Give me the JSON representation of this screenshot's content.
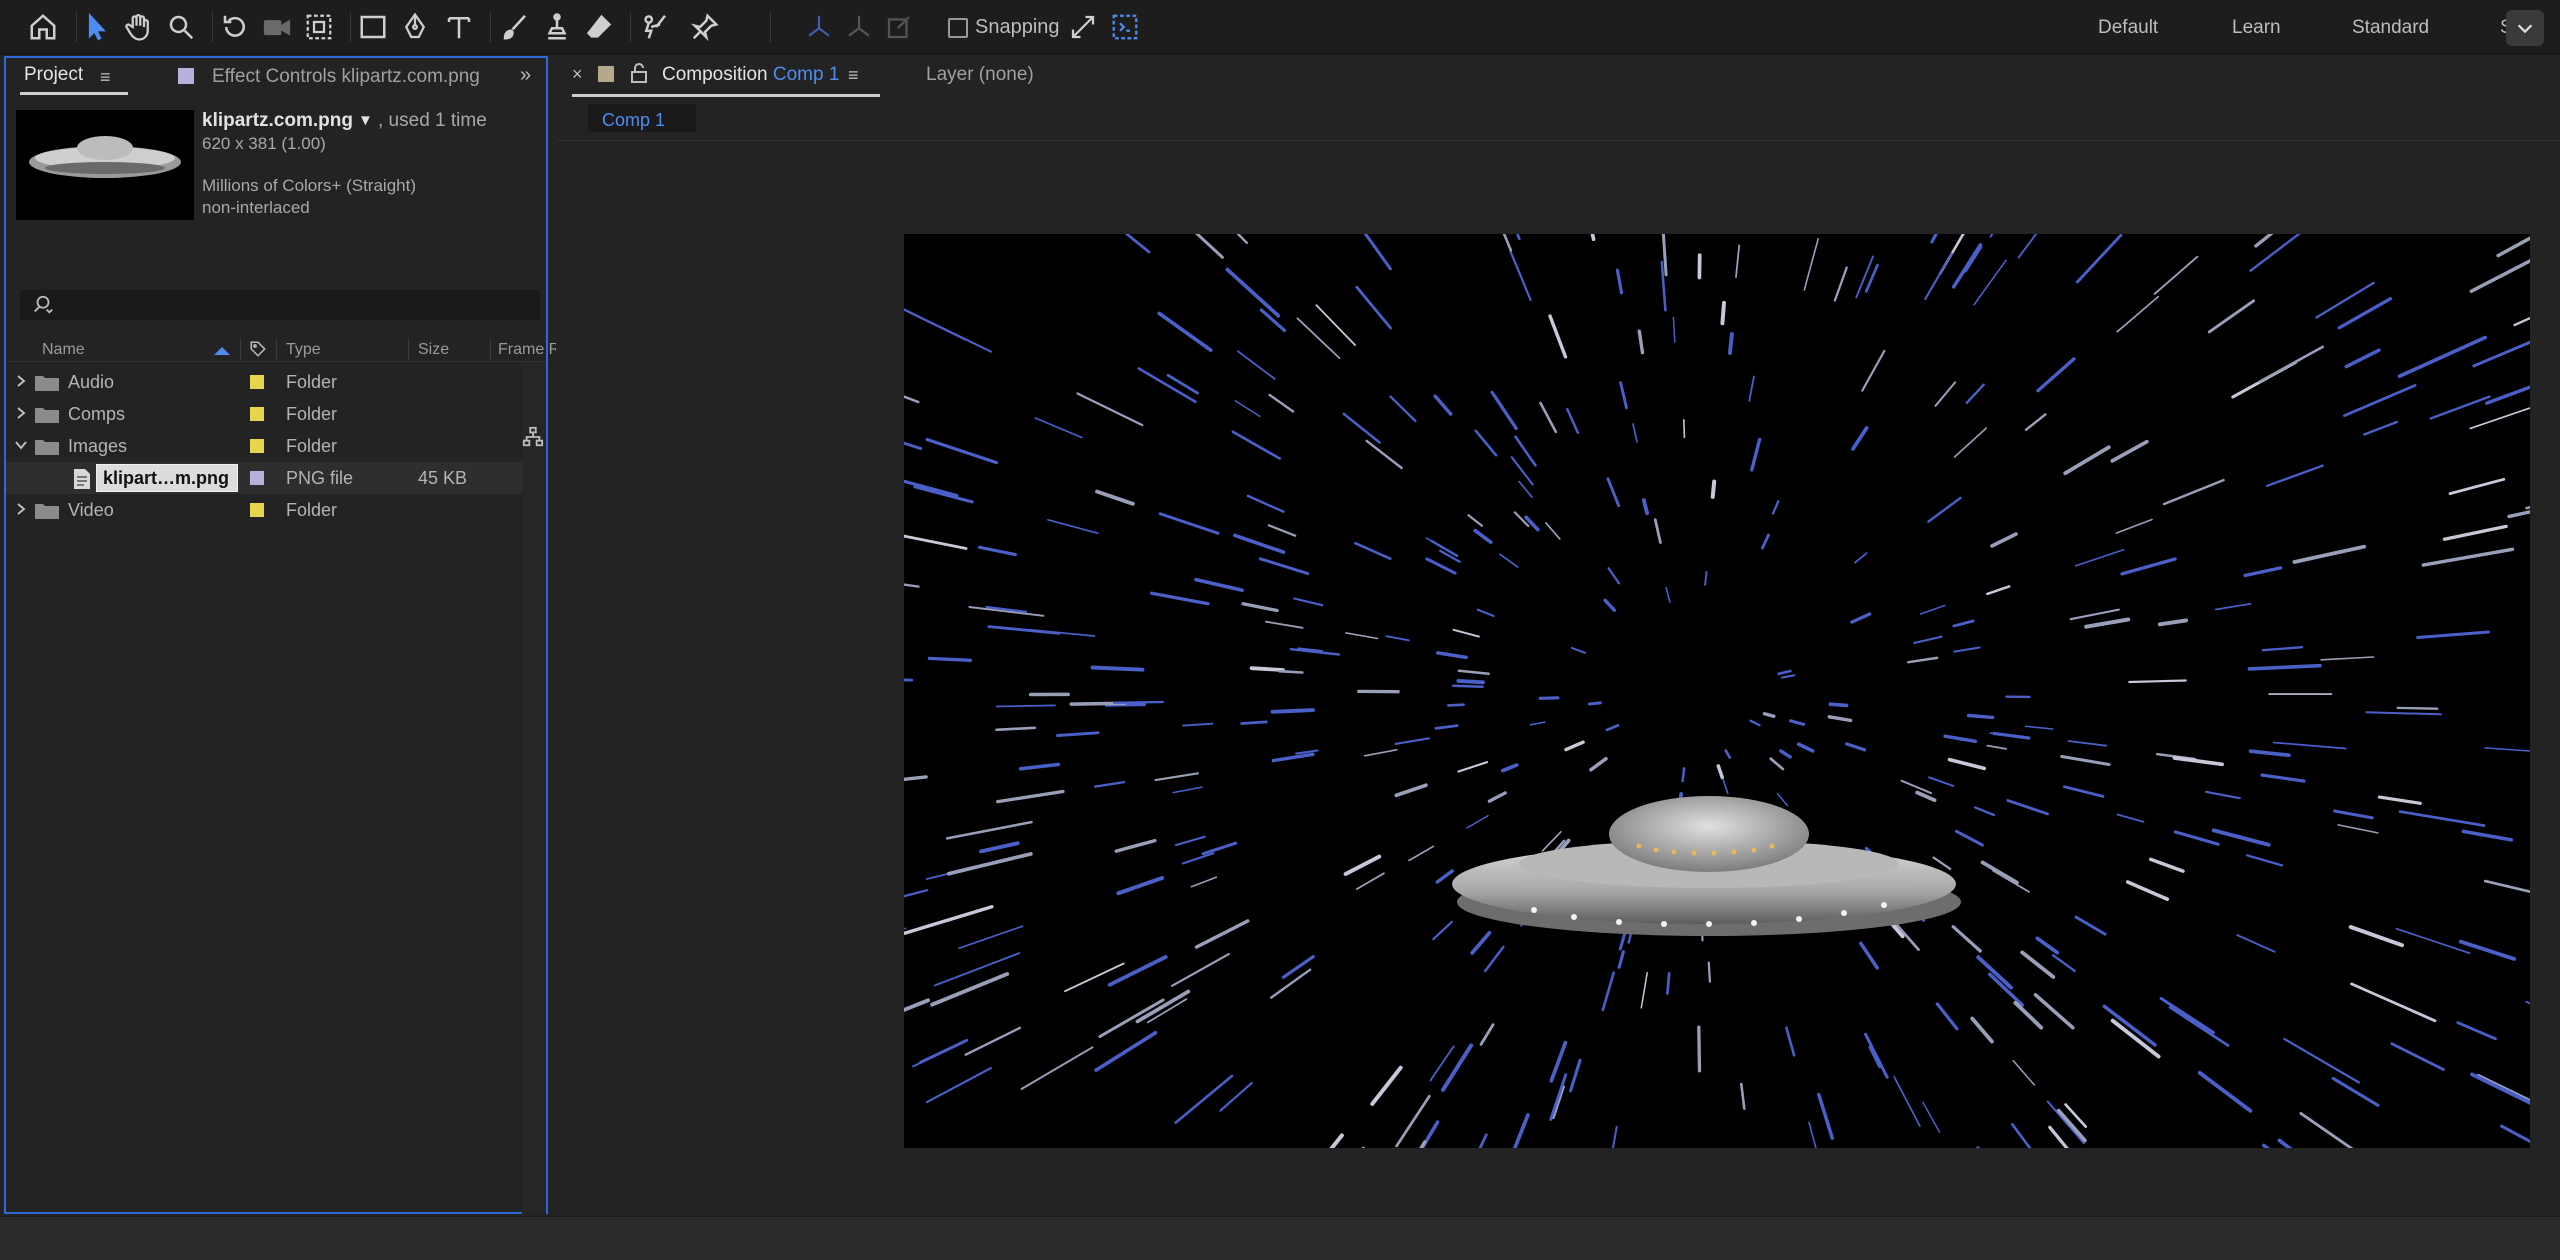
{
  "toolbar": {
    "snapping_label": "Snapping",
    "snapping_checked": false,
    "workspaces": [
      "Default",
      "Learn",
      "Standard",
      "S"
    ],
    "tools": [
      {
        "name": "home-icon"
      },
      {
        "name": "selection-tool-icon",
        "active": true
      },
      {
        "name": "hand-tool-icon"
      },
      {
        "name": "zoom-tool-icon"
      },
      {
        "name": "rotate-tool-icon"
      },
      {
        "name": "camera-tool-icon"
      },
      {
        "name": "pan-behind-tool-icon"
      },
      {
        "name": "rectangle-tool-icon"
      },
      {
        "name": "pen-tool-icon"
      },
      {
        "name": "type-tool-icon"
      },
      {
        "name": "brush-tool-icon"
      },
      {
        "name": "clone-stamp-tool-icon"
      },
      {
        "name": "eraser-tool-icon"
      },
      {
        "name": "roto-brush-tool-icon"
      },
      {
        "name": "puppet-pin-tool-icon"
      }
    ]
  },
  "project_panel": {
    "tab_label": "Project",
    "effect_controls_tab": "Effect Controls klipartz.com.png",
    "info": {
      "name": "klipartz.com.png",
      "used": ", used 1 time",
      "dimensions": "620 x 381 (1.00)",
      "colors": "Millions of Colors+ (Straight)",
      "interlace": "non-interlaced"
    },
    "columns": {
      "name": "Name",
      "type": "Type",
      "size": "Size",
      "frame_rate": "Frame R"
    },
    "items": [
      {
        "name": "Audio",
        "type": "Folder",
        "size": "",
        "expanded": false,
        "label_color": "#e8d44d"
      },
      {
        "name": "Comps",
        "type": "Folder",
        "size": "",
        "expanded": false,
        "label_color": "#e8d44d"
      },
      {
        "name": "Images",
        "type": "Folder",
        "size": "",
        "expanded": true,
        "label_color": "#e8d44d"
      },
      {
        "name": "klipart…m.png",
        "type": "PNG file",
        "size": "45 KB",
        "child": true,
        "label_color": "#b7b1dc"
      },
      {
        "name": "Video",
        "type": "Folder",
        "size": "",
        "expanded": false,
        "label_color": "#e8d44d"
      }
    ]
  },
  "composition_panel": {
    "tab_prefix": "Composition",
    "tab_name": "Comp 1",
    "layer_tab": "Layer (none)",
    "subtab": "Comp 1"
  },
  "colors": {
    "accent": "#4e8cf2",
    "panel_focus_border": "#2f6ad4",
    "folder_label": "#e8d44d",
    "file_label": "#b7b1dc",
    "star_blue": "#4b5fc9"
  }
}
